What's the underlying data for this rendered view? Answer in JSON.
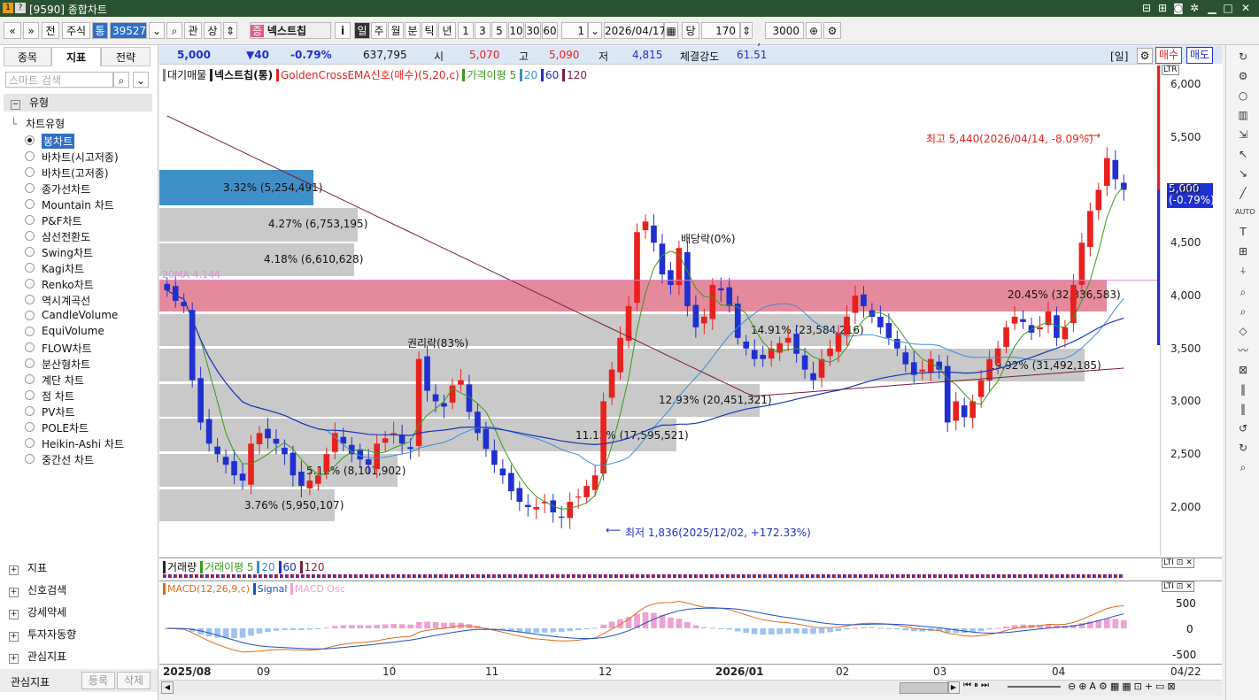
{
  "window": {
    "title": "[9590] 종합차트"
  },
  "toolbar": {
    "market": "주식",
    "mode_btn": "통",
    "code": "395270",
    "stock_name": "넥스트칩",
    "btn_jeon": "전",
    "btn_gwan": "관",
    "btn_sang": "상",
    "btn_i": "i",
    "period_labels": [
      "일",
      "주",
      "월",
      "분",
      "틱",
      "년"
    ],
    "intervals": [
      "1",
      "3",
      "5",
      "10",
      "30",
      "60"
    ],
    "interval_value": "1",
    "date": "2026/04/17",
    "dang": "당",
    "count": "170",
    "total": "3000",
    "slash": "/"
  },
  "left_panel": {
    "tabs": [
      "종목",
      "지표",
      "전략"
    ],
    "search_placeholder": "스마트 검색",
    "section_type": "유형",
    "tree_root": "차트유형",
    "chart_types": [
      "봉차트",
      "바차트(시고저종)",
      "바차트(고저종)",
      "종가선차트",
      "Mountain 차트",
      "P&F차트",
      "삼선전환도",
      "Swing차트",
      "Kagi차트",
      "Renko차트",
      "역시계곡선",
      "CandleVolume",
      "EquiVolume",
      "FLOW차트",
      "분산형차트",
      "계단 차트",
      "점 차트",
      "PV차트",
      "POLE차트",
      "Heikin-Ashi 차트",
      "중간선 차트"
    ],
    "selected_type": "봉차트",
    "bottom_items": [
      "지표",
      "신호검색",
      "강세약세",
      "투자자동향",
      "관심지표"
    ],
    "fav_label": "관심지표",
    "btn_register": "등록",
    "btn_delete": "삭제"
  },
  "infobar": {
    "price": "5,000",
    "change": "▼40",
    "change_pct": "-0.79%",
    "volume": "637,795",
    "open_label": "시",
    "open": "5,070",
    "high_label": "고",
    "high": "5,090",
    "low_label": "저",
    "low": "4,815",
    "strength_label": "체결강도",
    "strength": "61.51",
    "period_tag": "[일]",
    "buy": "매수",
    "sell": "매도"
  },
  "legend": {
    "items": [
      "대기매물",
      "넥스트칩(통)",
      "GoldenCrossEMA신호(매수)(5,20,c)",
      "가격이평 5",
      "20",
      "60",
      "120"
    ]
  },
  "price_axis": {
    "ticks": [
      "6,000",
      "5,500",
      "5,000",
      "4,500",
      "4,000",
      "3,500",
      "3,000",
      "2,500",
      "2,000"
    ],
    "current_label": "5,000",
    "current_pct": "(-0.79%)"
  },
  "annotations": {
    "high": "최고 5,440(2026/04/14, -8.09%)",
    "low": "최저 1,836(2025/12/02, +172.33%)",
    "dividend": "배당락(0%)",
    "rights": "권리락(83%)",
    "ma_tag": "20MA 4,144"
  },
  "volume_bands": [
    {
      "label": "3.32% (5,254,491)"
    },
    {
      "label": "4.27% (6,753,195)"
    },
    {
      "label": "4.18% (6,610,628)"
    },
    {
      "label": "20.45% (32,336,583)"
    },
    {
      "label": "14.91% (23,584,216)"
    },
    {
      "label": "19.92% (31,492,185)"
    },
    {
      "label": "12.93% (20,451,321)"
    },
    {
      "label": "11.13% (17,595,521)"
    },
    {
      "label": "5.12% (8,101,902)"
    },
    {
      "label": "3.76% (5,950,107)"
    }
  ],
  "volume_panel": {
    "legend": [
      "거래량",
      "거래이평 5",
      "20",
      "60",
      "120"
    ]
  },
  "macd_panel": {
    "legend": [
      "MACD(12,26,9,c)",
      "Signal",
      "MACD Osc"
    ],
    "ticks": [
      "500",
      "0",
      "-500"
    ]
  },
  "x_axis": {
    "labels": [
      "2025/08",
      "09",
      "10",
      "11",
      "12",
      "2026/01",
      "02",
      "03",
      "04",
      "04/22"
    ]
  },
  "colors": {
    "up": "#e8211d",
    "down": "#1f2fd0",
    "pinkband": "#e58a9c",
    "blueband": "#3f8fc9",
    "grayband": "#c9c9c9",
    "ma5": "#3a9a1a",
    "ma20": "#3a8ed6",
    "ma60": "#1b34b8",
    "ma120": "#7a1e3a"
  },
  "chart_data": {
    "type": "candlestick",
    "title": "넥스트칩(통)",
    "ylim": [
      1836,
      6100
    ],
    "x_labels": [
      "2025/08",
      "09",
      "10",
      "11",
      "12",
      "2026/01",
      "02",
      "03",
      "04"
    ],
    "close_series_approx": [
      4050,
      3950,
      3900,
      3200,
      2800,
      2600,
      2500,
      2400,
      2300,
      2250,
      2600,
      2700,
      2650,
      2600,
      2500,
      2300,
      2200,
      2250,
      2300,
      2500,
      2700,
      2600,
      2500,
      2450,
      2400,
      2600,
      2650,
      2700,
      2600,
      2550,
      3400,
      3100,
      3000,
      2950,
      3150,
      3200,
      2900,
      2700,
      2550,
      2400,
      2300,
      2150,
      2050,
      2000,
      2000,
      2050,
      1950,
      1900,
      2050,
      2100,
      2200,
      2300,
      3000,
      3300,
      3600,
      3900,
      4600,
      4700,
      4500,
      4200,
      4100,
      4450,
      3900,
      3700,
      3800,
      4100,
      4050,
      3900,
      3600,
      3500,
      3400,
      3400,
      3500,
      3550,
      3600,
      3450,
      3300,
      3200,
      3400,
      3500,
      3650,
      3800,
      4000,
      3900,
      3800,
      3700,
      3600,
      3500,
      3350,
      3250,
      3300,
      3400,
      3300,
      2800,
      3000,
      2850,
      3000,
      3200,
      3400,
      3500,
      3700,
      3800,
      3750,
      3650,
      3700,
      3850,
      3600,
      3700,
      4100,
      4500,
      4800,
      5000,
      5300,
      5100,
      5000
    ],
    "ma_series": [
      "5",
      "20",
      "60",
      "120"
    ],
    "events": [
      {
        "type": "high",
        "value": 5440,
        "date": "2026/04/14"
      },
      {
        "type": "low",
        "value": 1836,
        "date": "2025/12/02"
      }
    ]
  }
}
